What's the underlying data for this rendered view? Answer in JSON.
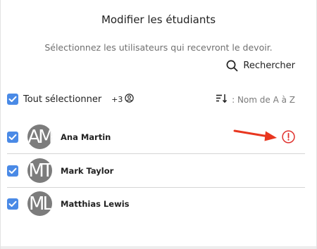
{
  "dialog": {
    "title": "Modifier les étudiants",
    "subtitle": "Sélectionnez les utilisateurs qui recevront le devoir.",
    "search_label": "Rechercher"
  },
  "selection": {
    "select_all_label": "Tout sélectionner",
    "extra_count": "+3",
    "sort_label": ": Nom de A à Z"
  },
  "students": [
    {
      "name": "Ana Martin",
      "initials": "AM",
      "checked": true,
      "warning": true
    },
    {
      "name": "Mark Taylor",
      "initials": "MT",
      "checked": true,
      "warning": false
    },
    {
      "name": "Matthias Lewis",
      "initials": "ML",
      "checked": true,
      "warning": false
    }
  ],
  "colors": {
    "accent": "#4a8ae6",
    "warning": "#e0322e",
    "annotation_arrow": "#e8361f",
    "avatar": "#7c7c7c"
  },
  "icons": [
    "search-icon",
    "user-circle-icon",
    "sort-icon",
    "checkmark-icon",
    "alert-icon",
    "arrow-icon"
  ]
}
